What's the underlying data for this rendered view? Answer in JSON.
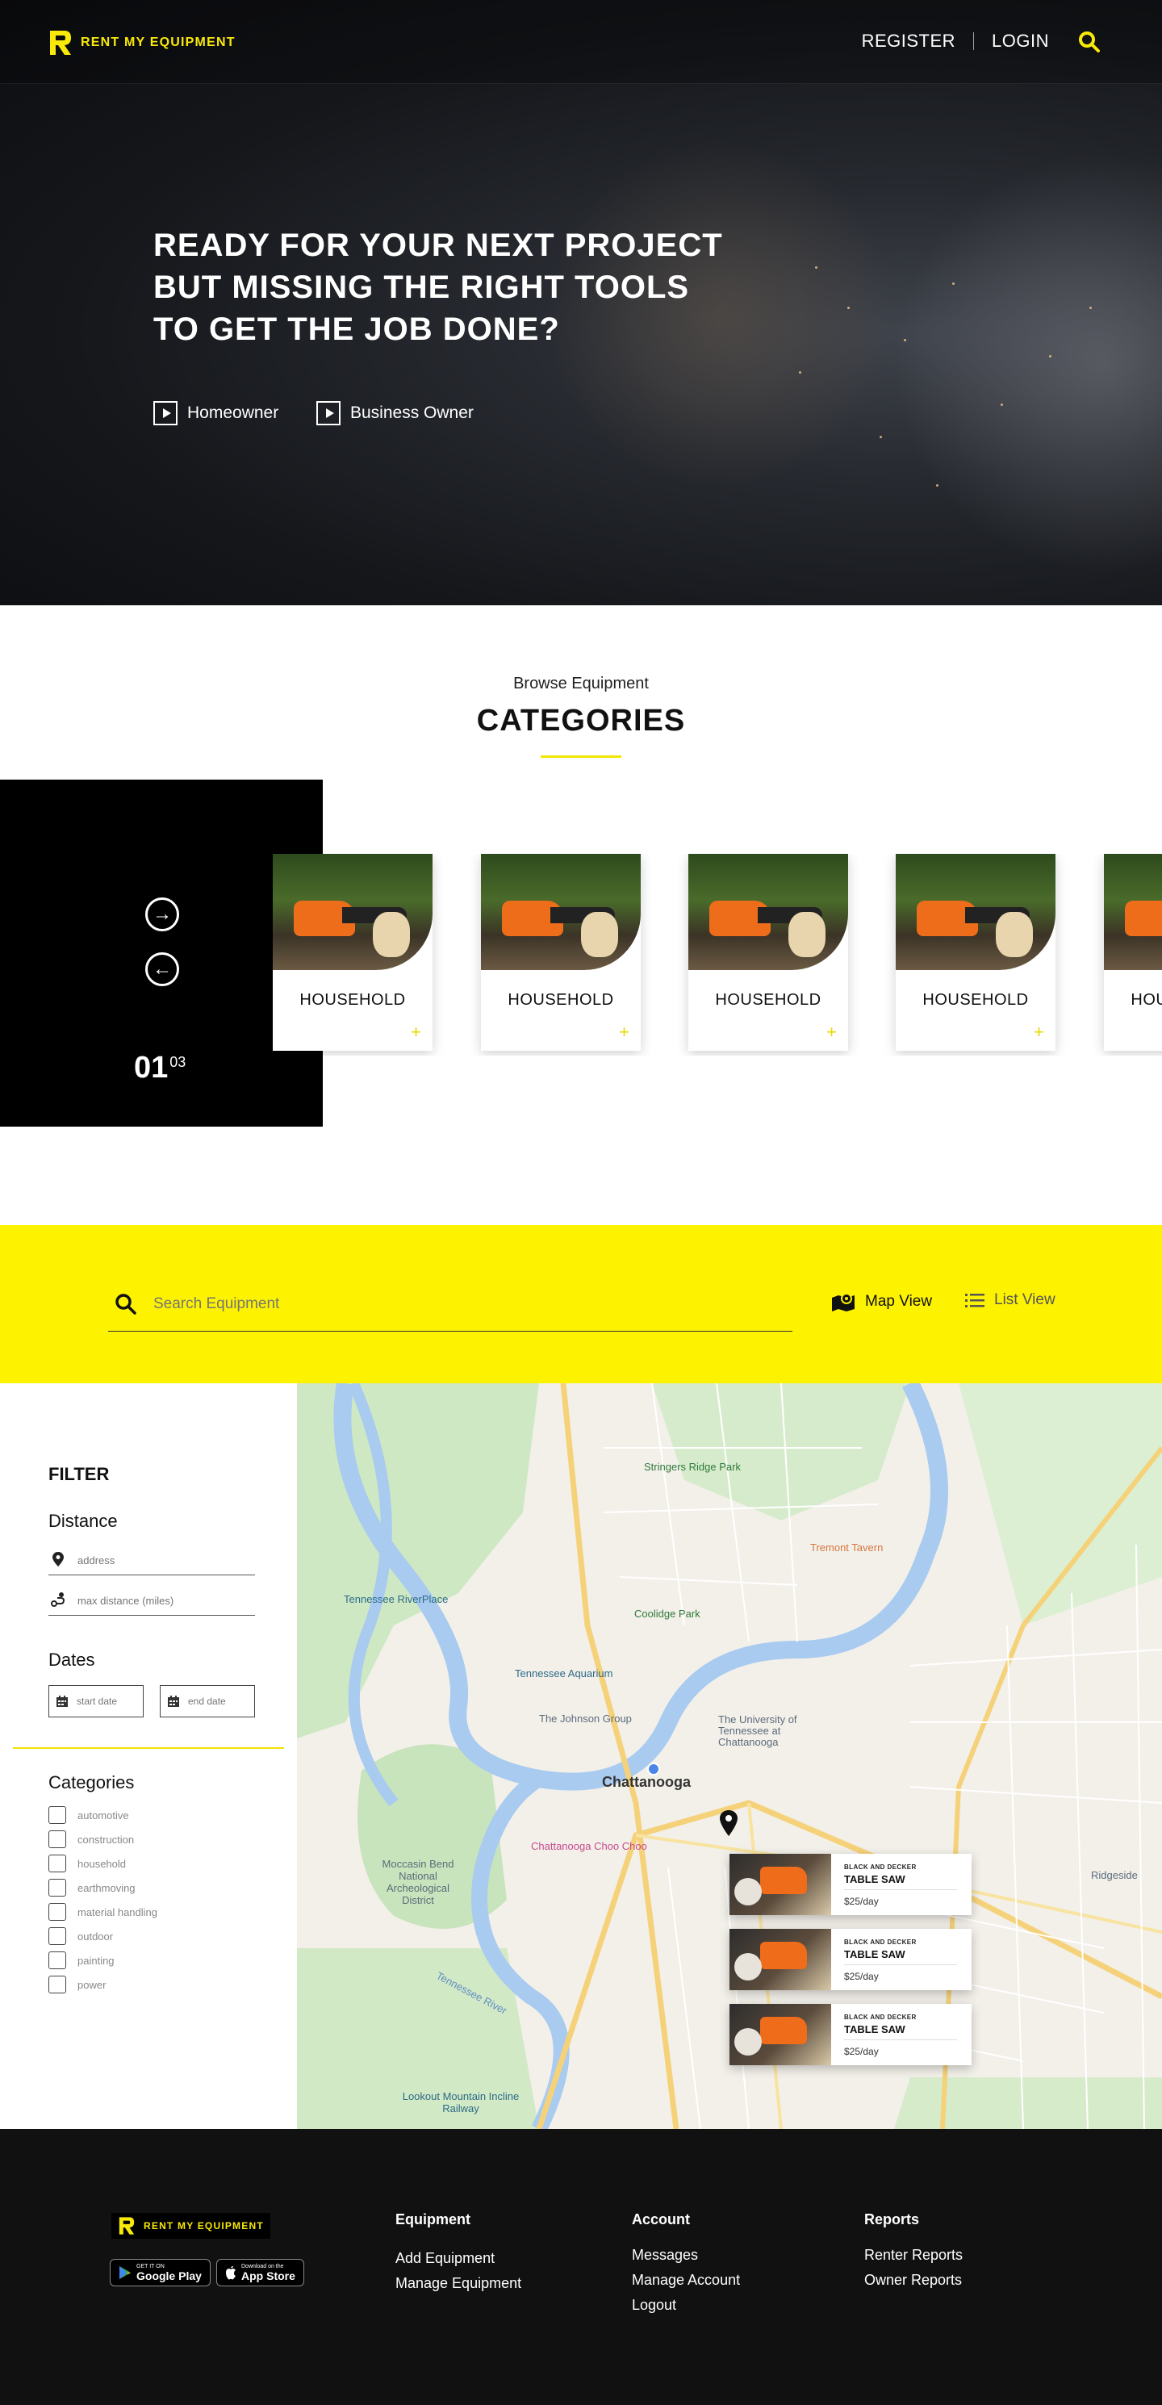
{
  "brand": {
    "name": "RENT MY EQUIPMENT",
    "accent": "#fdf200"
  },
  "nav": {
    "register": "REGISTER",
    "login": "LOGIN"
  },
  "hero": {
    "title_lines": [
      "READY FOR YOUR NEXT PROJECT",
      "BUT MISSING THE RIGHT TOOLS",
      "TO GET THE JOB DONE?"
    ],
    "buttons": [
      "Homeowner",
      "Business Owner"
    ]
  },
  "categories": {
    "subtitle": "Browse Equipment",
    "title": "CATEGORIES",
    "counter_current": "01",
    "counter_total": "03",
    "cards": [
      {
        "label": "HOUSEHOLD"
      },
      {
        "label": "HOUSEHOLD"
      },
      {
        "label": "HOUSEHOLD"
      },
      {
        "label": "HOUSEHOLD"
      },
      {
        "label": "HOUSEHOLD"
      }
    ]
  },
  "search": {
    "placeholder": "Search Equipment",
    "map_view": "Map View",
    "list_view": "List View"
  },
  "filter": {
    "title": "FILTER",
    "distance": {
      "heading": "Distance",
      "address_placeholder": "address",
      "max_distance_placeholder": "max distance (miles)"
    },
    "dates": {
      "heading": "Dates",
      "start_placeholder": "start date",
      "end_placeholder": "end date"
    },
    "categories": {
      "heading": "Categories",
      "options": [
        "automotive",
        "construction",
        "household",
        "earthmoving",
        "material handling",
        "outdoor",
        "painting",
        "power"
      ]
    }
  },
  "map": {
    "city": "Chattanooga",
    "labels": [
      "Stringers Ridge Park",
      "Tremont Tavern",
      "Tennessee RiverPlace",
      "Coolidge Park",
      "Tennessee Aquarium",
      "The Johnson Group",
      "The University of Tennessee at Chattanooga",
      "Chattanooga Choo Choo",
      "Moccasin Bend National Archeological District",
      "Lookout Mountain Incline Railway",
      "Ridgeside",
      "Tennessee River"
    ],
    "listings": [
      {
        "brand": "BLACK AND DECKER",
        "name": "TABLE SAW",
        "price": "$25/day"
      },
      {
        "brand": "BLACK AND DECKER",
        "name": "TABLE SAW",
        "price": "$25/day"
      },
      {
        "brand": "BLACK AND DECKER",
        "name": "TABLE SAW",
        "price": "$25/day"
      }
    ]
  },
  "footer": {
    "google_play": {
      "small": "GET IT ON",
      "big": "Google Play"
    },
    "app_store": {
      "small": "Download on the",
      "big": "App Store"
    },
    "columns": [
      {
        "title": "Equipment",
        "links": [
          "Add Equipment",
          "Manage Equipment"
        ]
      },
      {
        "title": "Account",
        "links": [
          "Messages",
          "Manage Account",
          "Logout"
        ]
      },
      {
        "title": "Reports",
        "links": [
          "Renter Reports",
          "Owner Reports"
        ]
      }
    ]
  }
}
